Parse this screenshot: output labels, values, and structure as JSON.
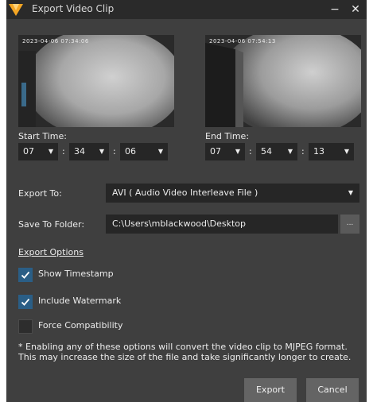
{
  "window": {
    "title": "Export Video Clip",
    "minimize": "−",
    "close": "✕"
  },
  "previews": {
    "start_stamp": "2023-04-06  07:34:06",
    "end_stamp": "2023-04-06  07:54:13"
  },
  "start_time": {
    "label": "Start Time:",
    "hour": "07",
    "minute": "34",
    "second": "06"
  },
  "end_time": {
    "label": "End Time:",
    "hour": "07",
    "minute": "54",
    "second": "13"
  },
  "separator": ":",
  "export_to": {
    "label": "Export To:",
    "value": "AVI ( Audio Video Interleave File )"
  },
  "save_to": {
    "label": "Save To Folder:",
    "value": "C:\\Users\\mblackwood\\Desktop",
    "browse_label": "..."
  },
  "options": {
    "heading": "Export Options",
    "show_timestamp": {
      "label": "Show Timestamp",
      "checked": true
    },
    "include_watermark": {
      "label": "Include Watermark",
      "checked": true
    },
    "force_compatibility": {
      "label": "Force Compatibility",
      "checked": false
    }
  },
  "note": "* Enabling any of these options will convert the video clip to MJPEG format.  This may increase the size of the file and take significantly longer to create.",
  "buttons": {
    "export": "Export",
    "cancel": "Cancel"
  },
  "colors": {
    "dialog_bg": "#3f3f3f",
    "titlebar_bg": "#2a2a2a",
    "field_bg": "#262626",
    "checkbox_checked": "#2a5e86",
    "button_bg": "#646464",
    "logo_orange": "#f5a623"
  },
  "icons": {
    "logo": "app-logo-v-shield",
    "dropdown": "caret-down-icon",
    "checkmark": "checkmark-icon"
  }
}
